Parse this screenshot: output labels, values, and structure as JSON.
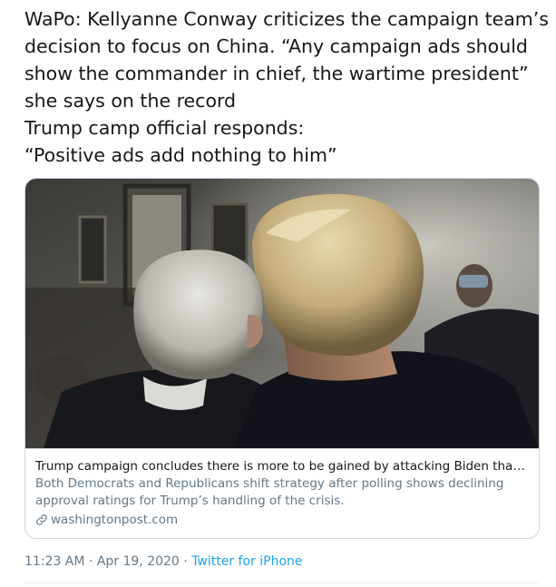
{
  "tweet": {
    "lines": [
      "WaPo: Kellyanne Conway criticizes the campaign team’s",
      "decision to focus on China. “Any campaign ads should",
      "show the commander in chief, the wartime president”",
      "she says on the record",
      "Trump camp official responds:",
      "“Positive ads add nothing to him”"
    ]
  },
  "card": {
    "image_icon": "photo-two-men-from-behind",
    "title": "Trump campaign concludes there is more to be gained by attacking Biden than t...",
    "description": "Both Democrats and Republicans shift strategy after polling shows declining approval ratings for Trump’s handling of the crisis.",
    "link_icon": "link-icon",
    "domain": "washingtonpost.com"
  },
  "meta": {
    "time": "11:23 AM",
    "separator1": " · ",
    "date": "Apr 19, 2020",
    "separator2": " · ",
    "source": "Twitter for iPhone"
  },
  "colors": {
    "text": "#14171a",
    "secondary": "#657786",
    "accent": "#1da1f2",
    "border": "#ccd6dd"
  }
}
